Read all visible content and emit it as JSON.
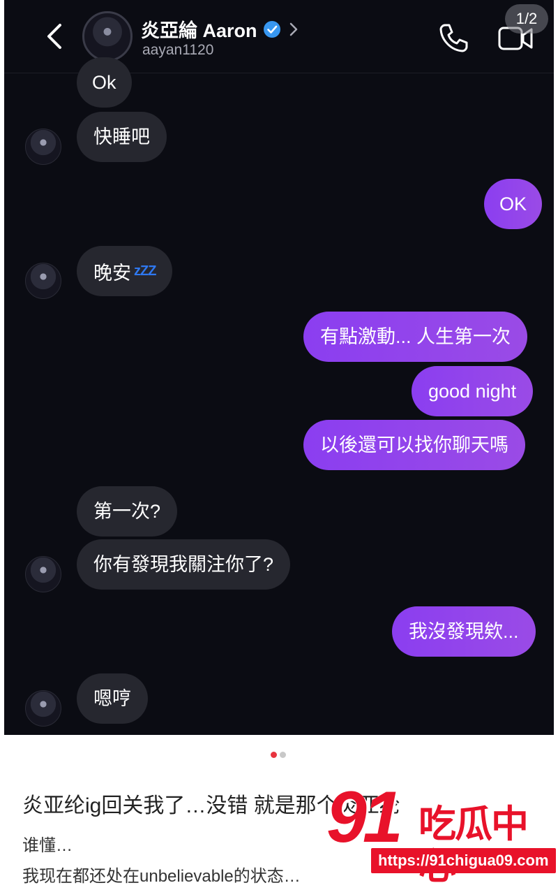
{
  "header": {
    "display_name": "炎亞綸 Aaron",
    "username": "aayan1120",
    "page_indicator": "1/2",
    "verified_color": "#3897f0"
  },
  "messages": [
    {
      "from": "them",
      "text": "Ok"
    },
    {
      "from": "them",
      "text": "快睡吧"
    },
    {
      "from": "me",
      "text": "OK"
    },
    {
      "from": "them",
      "text": "晚安",
      "emoji": "zzz-icon",
      "emoji_text": "zZZ"
    },
    {
      "from": "me",
      "text": "有點激動... 人生第一次"
    },
    {
      "from": "me",
      "text": "good night"
    },
    {
      "from": "me",
      "text": "以後還可以找你聊天嗎"
    },
    {
      "from": "them",
      "text": "第一次?"
    },
    {
      "from": "them",
      "text": "你有發現我關注你了?"
    },
    {
      "from": "me",
      "text": "我沒發現欸..."
    },
    {
      "from": "them",
      "text": "嗯哼"
    }
  ],
  "carousel": {
    "active_color": "#e8343f",
    "inactive_color": "#c8c8c8"
  },
  "post": {
    "title": "炎亚纶ig回关我了…没错 就是那个炎亚纶",
    "line1": "谁懂…",
    "line2": "我现在都还处在unbelievable的状态…"
  },
  "watermark": {
    "number": "91",
    "name": "吃瓜中心",
    "url": "https://91chigua09.com",
    "color": "#e8122a"
  }
}
